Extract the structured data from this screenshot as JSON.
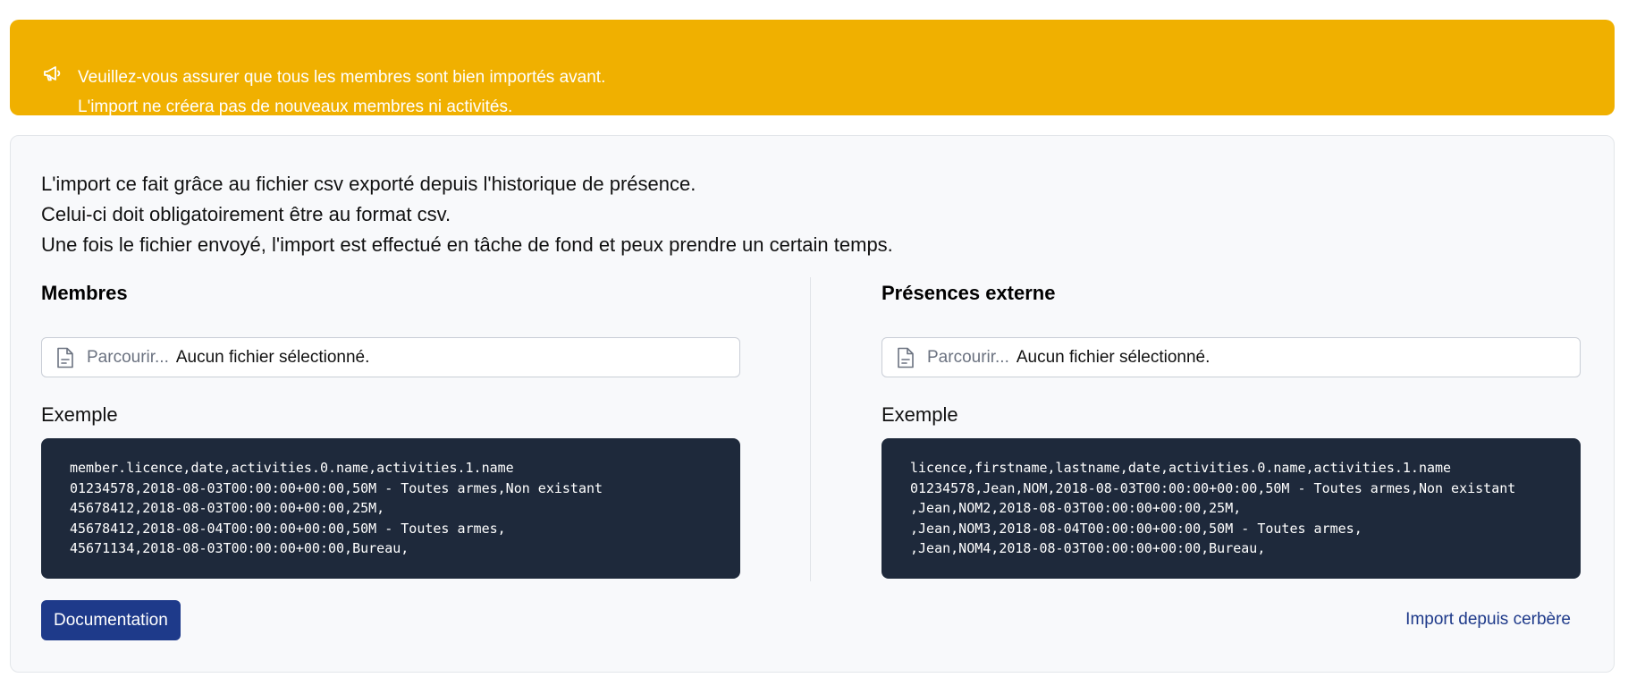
{
  "alert": {
    "icon": "megaphone-icon",
    "line1": "Veuillez-vous assurer que tous les membres sont bien importés avant.",
    "line2": "L'import ne créera pas de nouveaux membres ni activités.",
    "color": "#f0b000"
  },
  "intro": {
    "line1": "L'import ce fait grâce au fichier csv exporté depuis l'historique de présence.",
    "line2": "Celui-ci doit obligatoirement être au format csv.",
    "line3": "Une fois le fichier envoyé, l'import est effectué en tâche de fond et peux prendre un certain temps."
  },
  "members": {
    "title": "Membres",
    "browse_label": "Parcourir...",
    "file_status": "Aucun fichier sélectionné.",
    "example_label": "Exemple",
    "code_lines": [
      "member.licence,date,activities.0.name,activities.1.name",
      "01234578,2018-08-03T00:00:00+00:00,50M - Toutes armes,Non existant",
      "45678412,2018-08-03T00:00:00+00:00,25M,",
      "45678412,2018-08-04T00:00:00+00:00,50M - Toutes armes,",
      "45671134,2018-08-03T00:00:00+00:00,Bureau,"
    ]
  },
  "external": {
    "title": "Présences externe",
    "browse_label": "Parcourir...",
    "file_status": "Aucun fichier sélectionné.",
    "example_label": "Exemple",
    "code_lines": [
      "licence,firstname,lastname,date,activities.0.name,activities.1.name",
      "01234578,Jean,NOM,2018-08-03T00:00:00+00:00,50M - Toutes armes,Non existant",
      ",Jean,NOM2,2018-08-03T00:00:00+00:00,25M,",
      ",Jean,NOM3,2018-08-04T00:00:00+00:00,50M - Toutes armes,",
      ",Jean,NOM4,2018-08-03T00:00:00+00:00,Bureau,"
    ]
  },
  "footer": {
    "doc_button": "Documentation",
    "cerbere_link": "Import depuis cerbère"
  },
  "colors": {
    "primary": "#1e3a8a",
    "code_bg": "#1e293b",
    "card_bg": "#f8f9fb"
  }
}
